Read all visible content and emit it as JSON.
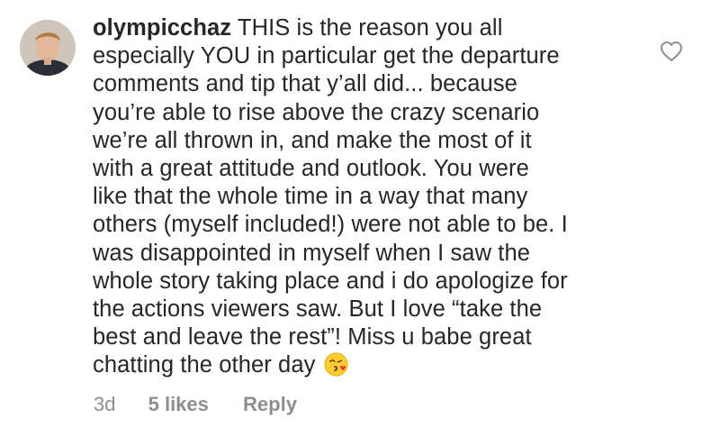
{
  "comment": {
    "username": "olympicchaz",
    "lines": [
      "THIS is the reason you all",
      "especially YOU in particular get the departure",
      "comments and tip that y’all did... because",
      "you’re able to rise above the crazy scenario",
      "we’re all thrown in, and make the most of it",
      "with a great attitude and outlook.  You were",
      "like that the whole time in a way that many",
      "others (myself included!) were not able to be.  I",
      "was disappointed in myself when I saw the",
      "whole story taking place and i do apologize for",
      "the actions viewers saw.  But I love “take the",
      "best and leave the rest”! Miss u babe great",
      "chatting the other day"
    ],
    "emoji": "face-blowing-a-kiss",
    "time": "3d",
    "likes": "5 likes",
    "reply": "Reply"
  },
  "icons": {
    "like": "heart-outline-icon"
  },
  "colors": {
    "text": "#262626",
    "meta": "#8e8e8e"
  }
}
